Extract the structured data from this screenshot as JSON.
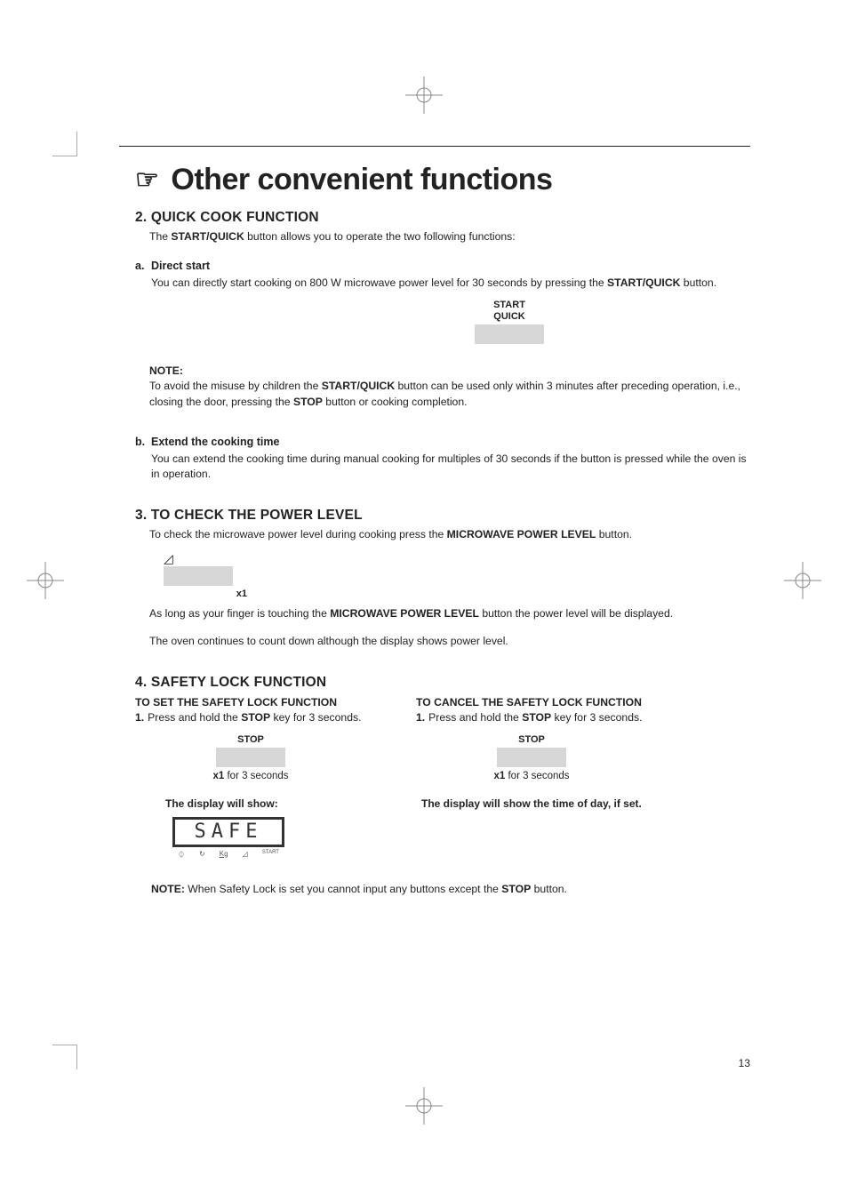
{
  "title": "Other convenient functions",
  "sections": {
    "quick": {
      "num": "2.",
      "heading": "QUICK COOK FUNCTION",
      "intro_p1": "The ",
      "intro_b1": "START/QUICK",
      "intro_p2": " button allows you to operate the two following functions:",
      "a": {
        "lbl": "a.",
        "title": "Direct start",
        "p1": "You can directly start cooking on 800 W microwave power level for 30 seconds by pressing the ",
        "b1": "START/QUICK",
        "p2": " button."
      },
      "start_btn_l1": "START",
      "start_btn_l2": "QUICK",
      "note_lbl": "NOTE:",
      "note_p1": "To avoid the misuse by children the ",
      "note_b1": "START/QUICK",
      "note_p2": " button can be used only within 3 minutes after preceding operation, i.e., closing the door, pressing the ",
      "note_b2": "STOP",
      "note_p3": " button or cooking completion.",
      "b": {
        "lbl": "b.",
        "title": "Extend the cooking time",
        "p1": "You can extend the cooking time during manual cooking for multiples of 30 seconds if the button is pressed while the oven is in operation."
      }
    },
    "power": {
      "num": "3.",
      "heading": "TO CHECK THE POWER LEVEL",
      "intro_p1": "To check the microwave power level during cooking press the ",
      "intro_b1": "MICROWAVE POWER LEVEL",
      "intro_p2": " button.",
      "x1": "x1",
      "p2a": "As long as your finger is touching the ",
      "p2b": "MICROWAVE POWER LEVEL",
      "p2c": " button the power level will be displayed.",
      "p3": "The oven continues to count down although the display shows power level."
    },
    "safety": {
      "num": "4.",
      "heading": "SAFETY LOCK FUNCTION",
      "set": {
        "title": "TO SET THE SAFETY LOCK FUNCTION",
        "step_num": "1.",
        "step_p1": "Press and hold the ",
        "step_b1": "STOP",
        "step_p2": " key for 3 seconds.",
        "btn_label": "STOP",
        "press_b": "x1",
        "press_t": " for 3 seconds",
        "disp": "The display will show:",
        "lcd": "SAFE"
      },
      "cancel": {
        "title": "TO CANCEL THE SAFETY LOCK FUNCTION",
        "step_num": "1.",
        "step_p1": "Press and hold the ",
        "step_b1": "STOP",
        "step_p2": " key for 3 seconds.",
        "btn_label": "STOP",
        "press_b": "x1",
        "press_t": " for 3 seconds",
        "disp": "The display will show the time of day, if set."
      },
      "footnote_b": "NOTE:",
      "footnote_p1": " When Safety Lock is set you cannot input any buttons except the ",
      "footnote_b2": "STOP",
      "footnote_p2": " button."
    }
  },
  "page_number": "13"
}
